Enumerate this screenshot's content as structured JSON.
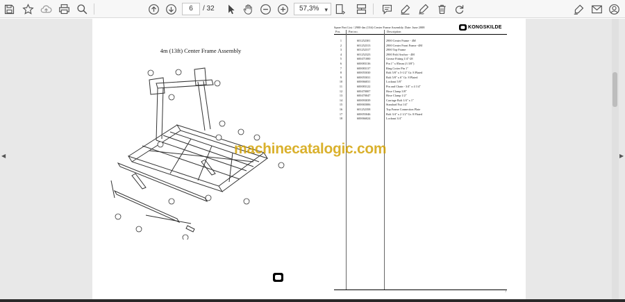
{
  "toolbar": {
    "page_current": "6",
    "page_total": "/ 32",
    "zoom": "57,3%",
    "icons": [
      "save-icon",
      "bookmark-star-icon",
      "upload-cloud-icon",
      "print-icon",
      "zoom-search-icon",
      "page-up-icon",
      "page-down-icon",
      "select-cursor-icon",
      "hand-tool-icon",
      "zoom-out-icon",
      "zoom-in-icon",
      "fit-page-icon",
      "scroll-mode-icon",
      "comment-icon",
      "highlight-pen-icon",
      "draw-icon",
      "delete-icon",
      "rotate-icon",
      "sign-icon",
      "email-icon",
      "account-icon"
    ]
  },
  "left_page": {
    "title": "4m (13ft) Center Frame Assembly",
    "page_number": "6",
    "callouts": [
      "1",
      "2",
      "3",
      "4",
      "5",
      "6",
      "7",
      "8",
      "9",
      "10",
      "11",
      "12",
      "13",
      "14",
      "15",
      "16",
      "17",
      "18"
    ]
  },
  "right_page": {
    "header": "Spare Part List / 2900-4m (13ft) Center Frame Assembly. Date: June 2008",
    "brand": "KONGSKILDE",
    "columns": [
      "Pos.",
      "Part no.",
      "Description"
    ],
    "page_number": "7",
    "rows": [
      {
        "pos": "1",
        "part": "601252301",
        "desc": "2900 Center Frame - 4M"
      },
      {
        "pos": "2",
        "part": "601252313",
        "desc": "2900 Center Front Frame -4M"
      },
      {
        "pos": "3",
        "part": "601252317",
        "desc": "2900 Top Frame"
      },
      {
        "pos": "4",
        "part": "601252323",
        "desc": "2900 Fold Anchor - 4M"
      },
      {
        "pos": "5",
        "part": "600471000",
        "desc": "Grease Fitting 1/4\"-28"
      },
      {
        "pos": "6",
        "part": "600083136",
        "desc": "Pin 1\" x 85mm (3 3/8\")"
      },
      {
        "pos": "7",
        "part": "600083137",
        "desc": "Ring Cotter Pin 1\""
      },
      {
        "pos": "8",
        "part": "600055030",
        "desc": "Bolt 5/8\" x 5-1/2\" Gr. 8 Plated"
      },
      {
        "pos": "9",
        "part": "600055031",
        "desc": "Bolt 5/8\" x 6\" Gr. 8 Plated"
      },
      {
        "pos": "10",
        "part": "600066031",
        "desc": "Locknut 5/8\""
      },
      {
        "pos": "11",
        "part": "600083122",
        "desc": "Pin and Chain - 3/4\" x 4 1/4\""
      },
      {
        "pos": "12",
        "part": "600470007",
        "desc": "Hose Clamp 3/8\""
      },
      {
        "pos": "13",
        "part": "600470047",
        "desc": "Hose Clamp 1/2\""
      },
      {
        "pos": "14",
        "part": "600093039",
        "desc": "Carriage Bolt 1/4\" x 1\""
      },
      {
        "pos": "15",
        "part": "600065006",
        "desc": "Standard Nut 1/4\""
      },
      {
        "pos": "16",
        "part": "601252358",
        "desc": "Top Frame Connection Plate"
      },
      {
        "pos": "17",
        "part": "600055046",
        "desc": "Bolt 3/4\" x 2 1/2\" Gr. 8 Plated"
      },
      {
        "pos": "18",
        "part": "600066024",
        "desc": "Locknut 3/4\""
      }
    ]
  },
  "watermark": "machinecatalogic.com",
  "colors": {
    "toolbar_bg": "#f7f7f7",
    "doc_bg": "#e8e8e8",
    "watermark": "#d2a000"
  }
}
